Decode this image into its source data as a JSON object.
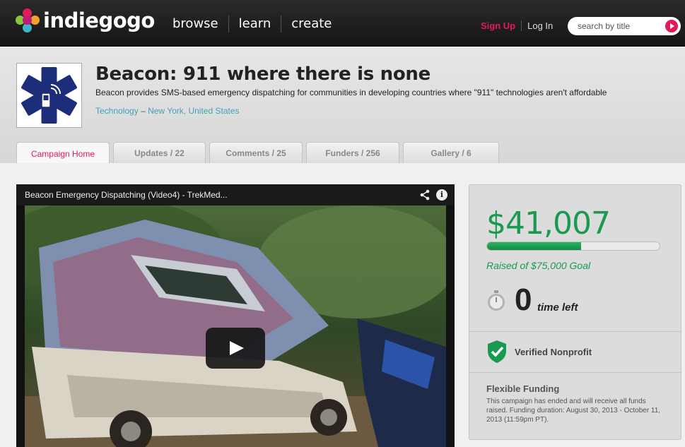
{
  "brand": {
    "name": "indiegogo",
    "colors": {
      "pink": "#e21a56",
      "green": "#1a9a50",
      "teal": "#3fa1b8"
    }
  },
  "nav": {
    "items": [
      "browse",
      "learn",
      "create"
    ]
  },
  "auth": {
    "signup": "Sign Up",
    "login": "Log In"
  },
  "search": {
    "placeholder": "search by title",
    "icon": "play-arrow-icon"
  },
  "campaign": {
    "title": "Beacon: 911 where there is none",
    "description": "Beacon provides SMS-based emergency dispatching for communities in developing countries where \"911\" technologies aren't affordable",
    "category": "Technology",
    "separator": "–",
    "location": "New York, United States",
    "logo_icon": "star-of-life-phone-icon"
  },
  "tabs": [
    "Campaign Home",
    "Updates / 22",
    "Comments / 25",
    "Funders / 256",
    "Gallery / 6"
  ],
  "video": {
    "title": "Beacon Emergency Dispatching (Video4) - TrekMed...",
    "info_glyph": "i"
  },
  "funding": {
    "raised": "$41,007",
    "goal_text": "Raised of $75,000 Goal",
    "progress_fraction": 0.547,
    "time_left_value": "0",
    "time_left_label": "time left",
    "verified": "Verified Nonprofit",
    "funding_type": "Flexible Funding",
    "funding_text": "This campaign has ended and will receive all funds raised. Funding duration: August 30, 2013 - October 11, 2013 (11:59pm PT)."
  }
}
